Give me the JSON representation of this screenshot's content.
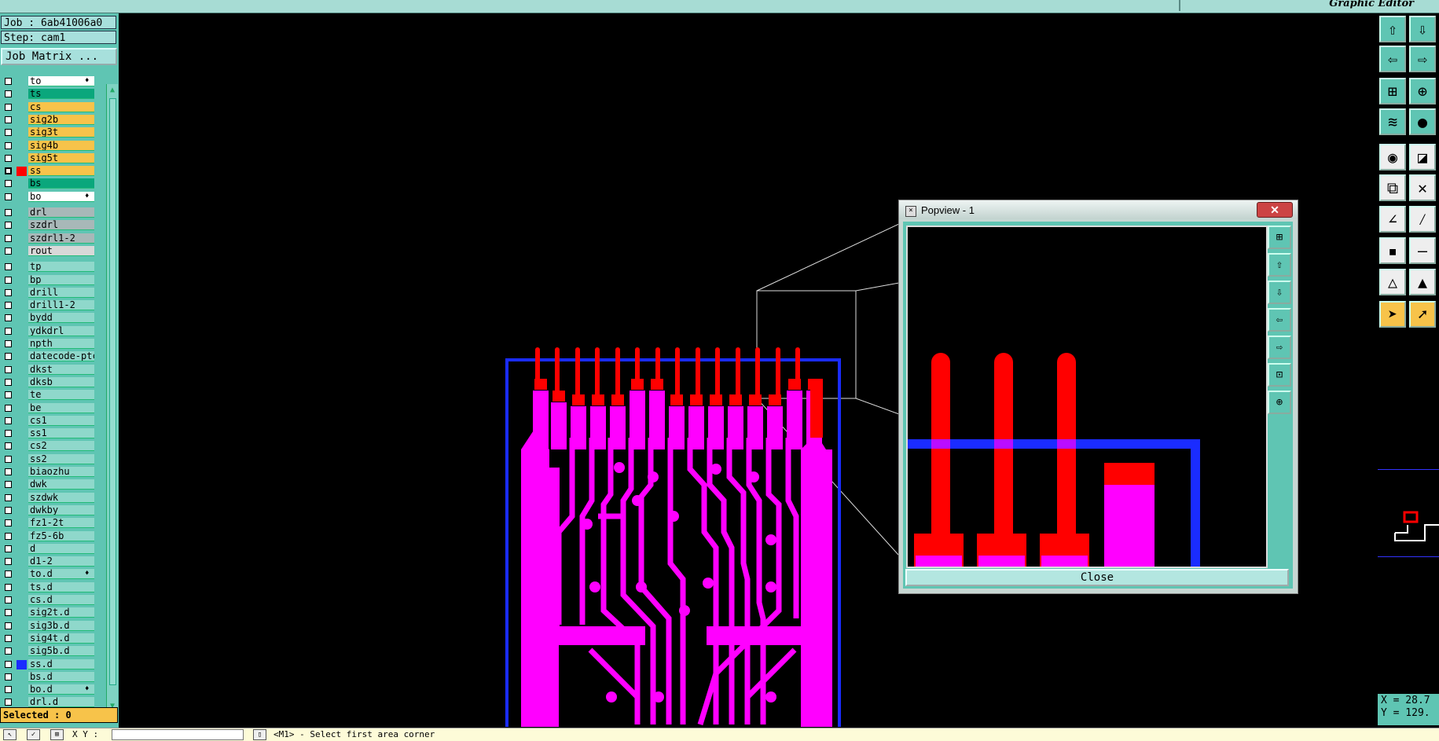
{
  "app": {
    "title": "Graphic Editor"
  },
  "job": {
    "label": "Job : 6ab41006a0",
    "step": "Step: cam1",
    "matrix_button": "Job Matrix ..."
  },
  "layers": [
    {
      "name": "to",
      "color": "#ffffff",
      "mark": "♦"
    },
    {
      "name": "ts",
      "color": "#0aa77c"
    },
    {
      "name": "cs",
      "color": "#f7c34a"
    },
    {
      "name": "sig2b",
      "color": "#f7c34a"
    },
    {
      "name": "sig3t",
      "color": "#f7c34a"
    },
    {
      "name": "sig4b",
      "color": "#f7c34a"
    },
    {
      "name": "sig5t",
      "color": "#f7c34a"
    },
    {
      "name": "ss",
      "color": "#f7c34a",
      "selected": true,
      "swatch": "#ff0000"
    },
    {
      "name": "bs",
      "color": "#0aa77c"
    },
    {
      "name": "bo",
      "color": "#ffffff",
      "mark": "♦"
    },
    {
      "name": "drl",
      "color": "#a8b8b8",
      "gap": true
    },
    {
      "name": "szdrl",
      "color": "#a8b8b8"
    },
    {
      "name": "szdrl1-2",
      "color": "#a8b8b8"
    },
    {
      "name": "rout",
      "color": "#d8d8d8"
    },
    {
      "name": "tp",
      "color": "#8fd8cb",
      "gap": true
    },
    {
      "name": "bp",
      "color": "#8fd8cb"
    },
    {
      "name": "drill",
      "color": "#8fd8cb"
    },
    {
      "name": "drill1-2",
      "color": "#8fd8cb"
    },
    {
      "name": "bydd",
      "color": "#8fd8cb"
    },
    {
      "name": "ydkdrl",
      "color": "#8fd8cb"
    },
    {
      "name": "npth",
      "color": "#8fd8cb"
    },
    {
      "name": "datecode-ptc",
      "color": "#8fd8cb"
    },
    {
      "name": "dkst",
      "color": "#8fd8cb"
    },
    {
      "name": "dksb",
      "color": "#8fd8cb"
    },
    {
      "name": "te",
      "color": "#8fd8cb"
    },
    {
      "name": "be",
      "color": "#8fd8cb"
    },
    {
      "name": "cs1",
      "color": "#8fd8cb"
    },
    {
      "name": "ss1",
      "color": "#8fd8cb"
    },
    {
      "name": "cs2",
      "color": "#8fd8cb"
    },
    {
      "name": "ss2",
      "color": "#8fd8cb"
    },
    {
      "name": "biaozhu",
      "color": "#8fd8cb"
    },
    {
      "name": "dwk",
      "color": "#8fd8cb"
    },
    {
      "name": "szdwk",
      "color": "#8fd8cb"
    },
    {
      "name": "dwkby",
      "color": "#8fd8cb"
    },
    {
      "name": "fz1-2t",
      "color": "#8fd8cb"
    },
    {
      "name": "fz5-6b",
      "color": "#8fd8cb"
    },
    {
      "name": "d",
      "color": "#8fd8cb"
    },
    {
      "name": "d1-2",
      "color": "#8fd8cb"
    },
    {
      "name": "to.d",
      "color": "#8fd8cb",
      "mark": "♦"
    },
    {
      "name": "ts.d",
      "color": "#8fd8cb"
    },
    {
      "name": "cs.d",
      "color": "#8fd8cb"
    },
    {
      "name": "sig2t.d",
      "color": "#8fd8cb"
    },
    {
      "name": "sig3b.d",
      "color": "#8fd8cb"
    },
    {
      "name": "sig4t.d",
      "color": "#8fd8cb"
    },
    {
      "name": "sig5b.d",
      "color": "#8fd8cb"
    },
    {
      "name": "ss.d",
      "color": "#8fd8cb",
      "swatch": "#1a2cff"
    },
    {
      "name": "bs.d",
      "color": "#8fd8cb"
    },
    {
      "name": "bo.d",
      "color": "#8fd8cb",
      "mark": "♦"
    },
    {
      "name": "drl.d",
      "color": "#8fd8cb"
    }
  ],
  "status": {
    "selected": "Selected : 0",
    "xy_label": "X Y :",
    "prompt": "<M1> - Select first area corner"
  },
  "coords": {
    "x": "X = 28.7",
    "y": "Y = 129."
  },
  "popview": {
    "title": "Popview - 1",
    "close_label": "Close"
  },
  "colors": {
    "layer_ss": "#ff0000",
    "overlay": "#ff00ff",
    "outline": "#1a2cff",
    "panel": "#5fc5b3"
  },
  "icons": [
    "zoom-in-icon",
    "zoom-out-icon",
    "pan-left-icon",
    "pan-right-icon",
    "fit-icon",
    "fit-center-icon",
    "snap-icon",
    "measure-icon",
    "select-icon",
    "move-icon",
    "connect-icon",
    "cross-icon",
    "line-icon",
    "line2-icon",
    "pad-icon",
    "dash-icon",
    "poly-icon",
    "triangle-icon",
    "pointer-icon",
    "pointer-alt-icon"
  ]
}
